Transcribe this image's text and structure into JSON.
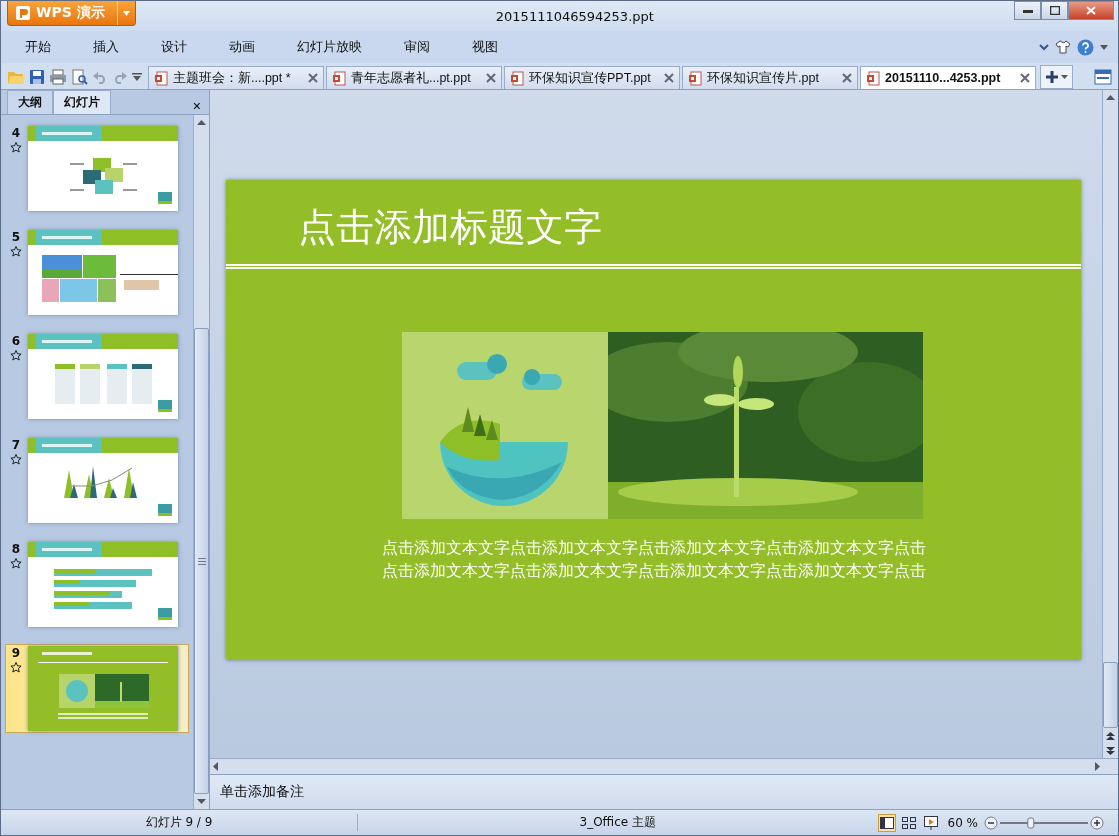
{
  "app_button": {
    "label": "WPS 演示"
  },
  "window": {
    "title": "2015111046594253.ppt"
  },
  "menu": [
    "开始",
    "插入",
    "设计",
    "动画",
    "幻灯片放映",
    "审阅",
    "视图"
  ],
  "doc_tabs": [
    {
      "label": "主题班会：新....ppt *",
      "selected": false
    },
    {
      "label": "青年志愿者礼...pt.ppt",
      "selected": false
    },
    {
      "label": "环保知识宣传PPT.ppt",
      "selected": false
    },
    {
      "label": "环保知识宣传片.ppt",
      "selected": false
    },
    {
      "label": "20151110...4253.ppt",
      "selected": true
    }
  ],
  "panel_tabs": [
    {
      "label": "大纲",
      "selected": false
    },
    {
      "label": "幻灯片",
      "selected": true
    }
  ],
  "panel_close": "×",
  "slides": [
    {
      "number": "4",
      "kind": "diagram",
      "selected": false
    },
    {
      "number": "5",
      "kind": "photos",
      "selected": false
    },
    {
      "number": "6",
      "kind": "columns",
      "selected": false
    },
    {
      "number": "7",
      "kind": "chart",
      "selected": false
    },
    {
      "number": "8",
      "kind": "bars",
      "selected": false
    },
    {
      "number": "9",
      "kind": "picture",
      "selected": true
    }
  ],
  "slide": {
    "title": "点击添加标题文字",
    "body": [
      "点击添加文本文字点击添加文本文字点击添加文本文字点击添加文本文字点击",
      "点击添加文本文字点击添加文本文字点击添加文本文字点击添加文本文字点击"
    ]
  },
  "notes": {
    "placeholder": "单击添加备注"
  },
  "status_bar": {
    "slide_count": "幻灯片 9 / 9",
    "theme": "3_Office 主题",
    "zoom": "60 %",
    "zoom_slider": {
      "level": 0.35
    }
  }
}
